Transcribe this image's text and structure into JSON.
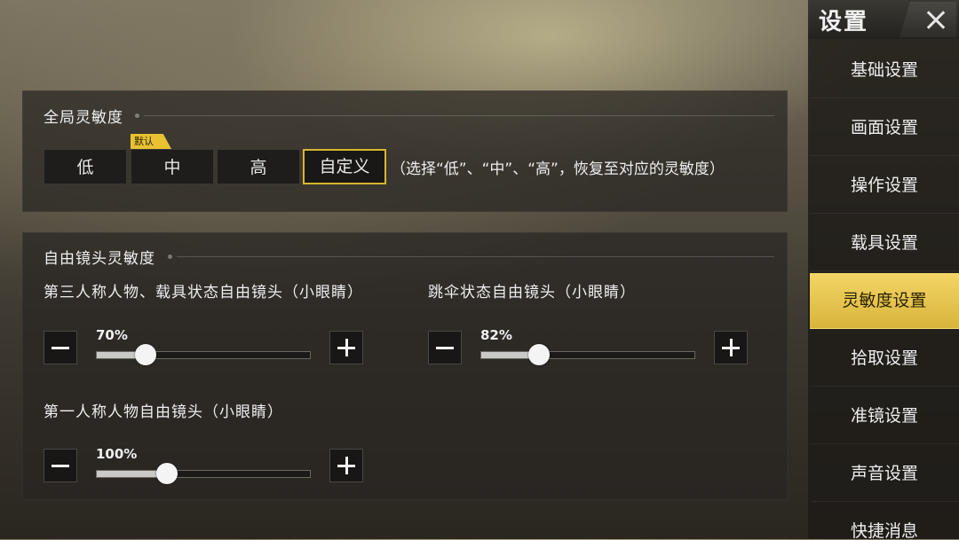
{
  "sidebar": {
    "title": "设置",
    "items": [
      {
        "label": "基础设置"
      },
      {
        "label": "画面设置"
      },
      {
        "label": "操作设置"
      },
      {
        "label": "载具设置"
      },
      {
        "label": "灵敏度设置",
        "active": true
      },
      {
        "label": "拾取设置"
      },
      {
        "label": "准镜设置"
      },
      {
        "label": "声音设置"
      },
      {
        "label": "快捷消息"
      }
    ]
  },
  "global_sensitivity": {
    "title": "全局灵敏度",
    "default_tag": "默认",
    "options": [
      "低",
      "中",
      "高",
      "自定义"
    ],
    "selected": "自定义",
    "hint": "（选择“低”、“中”、“高”，恢复至对应的灵敏度）"
  },
  "free_camera": {
    "title": "自由镜头灵敏度",
    "sliders": [
      {
        "label": "第三人称人物、载具状态自由镜头（小眼睛）",
        "value_text": "70%",
        "fraction": 0.23
      },
      {
        "label": "跳伞状态自由镜头（小眼睛）",
        "value_text": "82%",
        "fraction": 0.27
      },
      {
        "label": "第一人称人物自由镜头（小眼睛）",
        "value_text": "100%",
        "fraction": 0.33
      }
    ]
  },
  "colors": {
    "accent": "#d8b630",
    "active_nav": "#e8c54a"
  },
  "icons": {
    "close": "close-icon",
    "minus": "minus-icon",
    "plus": "plus-icon"
  }
}
